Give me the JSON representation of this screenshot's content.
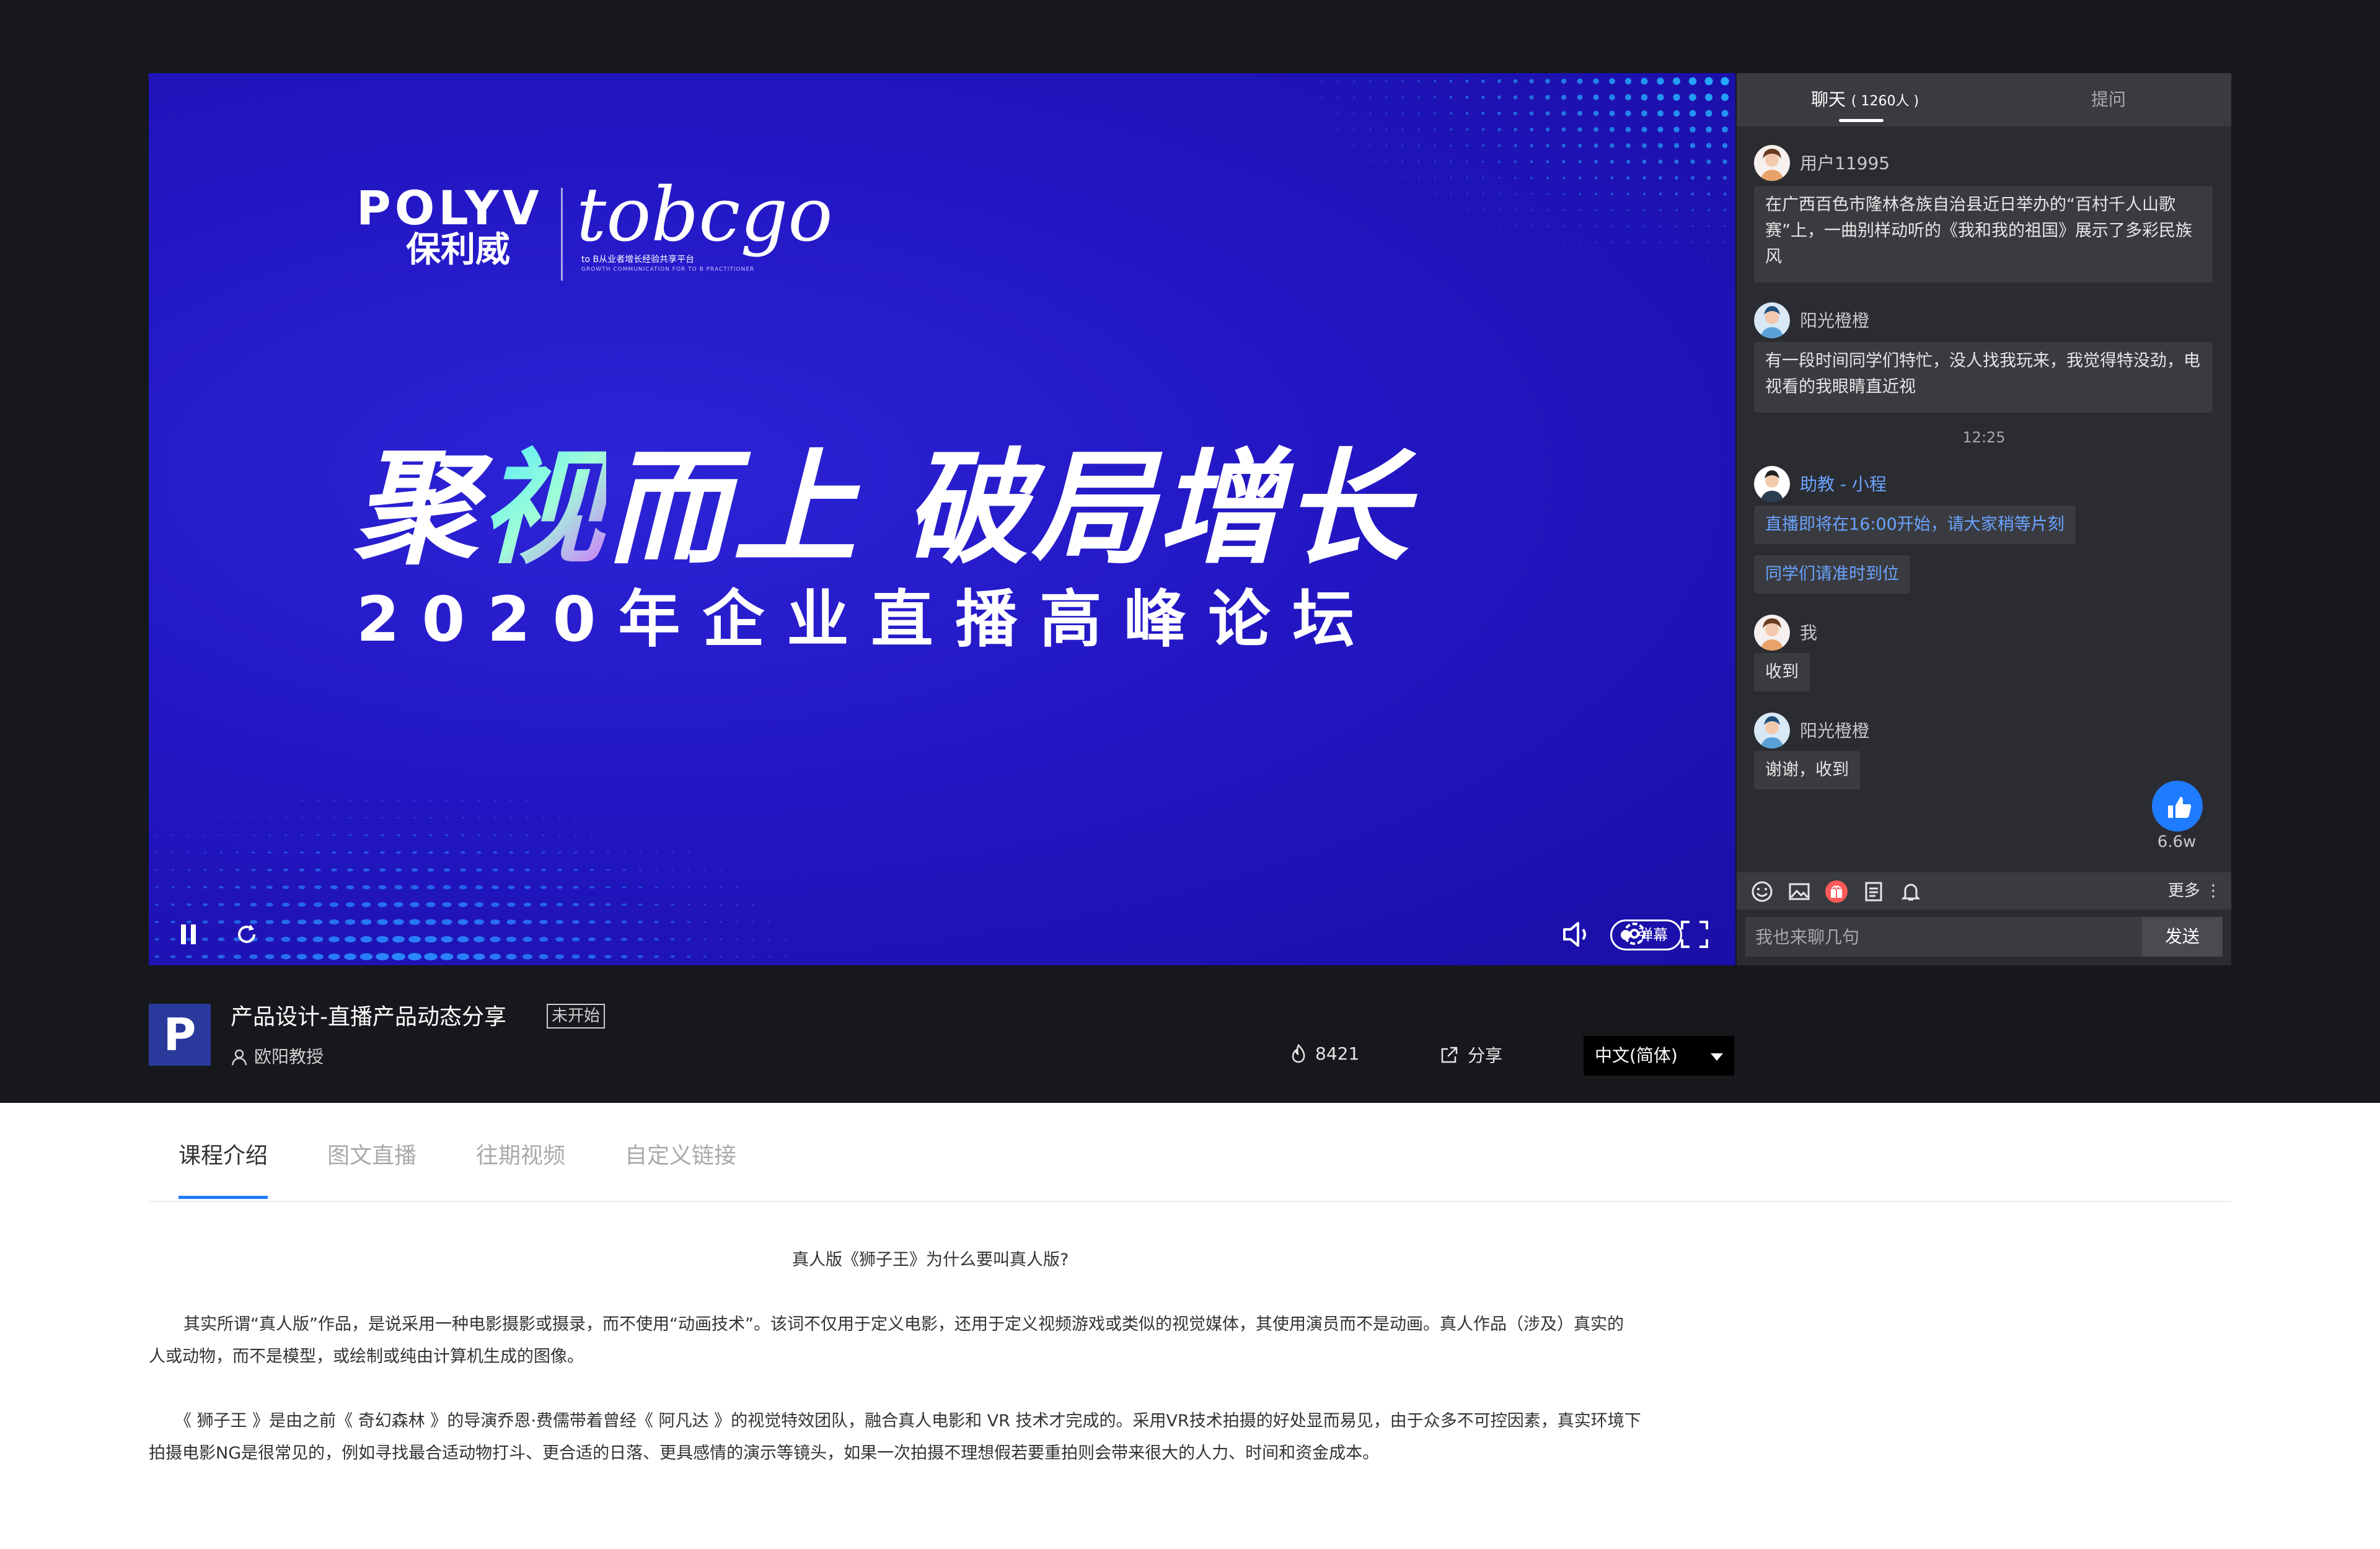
{
  "video": {
    "brand_polyv": "POLYV",
    "brand_polyv_cn": "保利威",
    "brand_tobgo": "tobcgo",
    "brand_tobgo_sub": "to B从业者增长经验共享平台",
    "brand_tobgo_sub2": "GROWTH COMMUNICATION FOR TO B PRACTITIONER",
    "headline_a": "聚",
    "headline_hl": "视",
    "headline_b": "而上 破局增长",
    "subhead": "2020年企业直播高峰论坛",
    "danmu_label": "弹幕"
  },
  "chat": {
    "tabs": [
      {
        "label": "聊天",
        "count": "( 1260人 )"
      },
      {
        "label": "提问"
      }
    ],
    "messages": [
      {
        "name": "用户11995",
        "text": "在广西百色市隆林各族自治县近日举办的“百村千人山歌赛”上，一曲别样动听的《我和我的祖国》展示了多彩民族风"
      },
      {
        "name": "阳光橙橙",
        "text": "有一段时间同学们特忙，没人找我玩来，我觉得特没劲，电视看的我眼睛直近视"
      },
      {
        "name": "助教 - 小程",
        "text1": "直播即将在16:00开始，请大家稍等片刻",
        "text2": "同学们请准时到位"
      },
      {
        "name": "我",
        "text": "收到"
      },
      {
        "name": "阳光橙橙",
        "text": "谢谢，收到"
      }
    ],
    "time_separator": "12:25",
    "like_count": "6.6w",
    "more_label": "更多",
    "input_placeholder": "我也来聊几句",
    "send_label": "发送"
  },
  "info": {
    "logo_letter": "P",
    "course_title": "产品设计-直播产品动态分享",
    "status_badge": "未开始",
    "author": "欧阳教授",
    "views": "8421",
    "share_label": "分享",
    "language": "中文(简体)"
  },
  "lower_tabs": [
    "课程介绍",
    "图文直播",
    "往期视频",
    "自定义链接"
  ],
  "article": {
    "title": "真人版《狮子王》为什么要叫真人版?",
    "p1_l1": "其实所谓“真人版”作品，是说采用一种电影摄影或摄录，而不使用“动画技术”。该词不仅用于定义电影，还用于定义视频游戏或类似的视觉媒体，其使用演员而不是动画。真人作品（涉及）真实的",
    "p1_l2": "人或动物，而不是模型，或绘制或纯由计算机生成的图像。",
    "p2_l1": "《 狮子王 》是由之前《 奇幻森林 》的导演乔恩·费儒带着曾经《 阿凡达 》的视觉特效团队，融合真人电影和 VR 技术才完成的。采用VR技术拍摄的好处显而易见，由于众多不可控因素，真实环境下",
    "p2_l2": "拍摄电影NG是很常见的，例如寻找最合适动物打斗、更合适的日落、更具感情的演示等镜头，如果一次拍摄不理想假若要重拍则会带来很大的人力、时间和资金成本。"
  },
  "colors": {
    "accent": "#1f7bff",
    "video_bg": "#2317c4",
    "chat_bg": "#2b2c31",
    "top_bg": "#17181c"
  }
}
